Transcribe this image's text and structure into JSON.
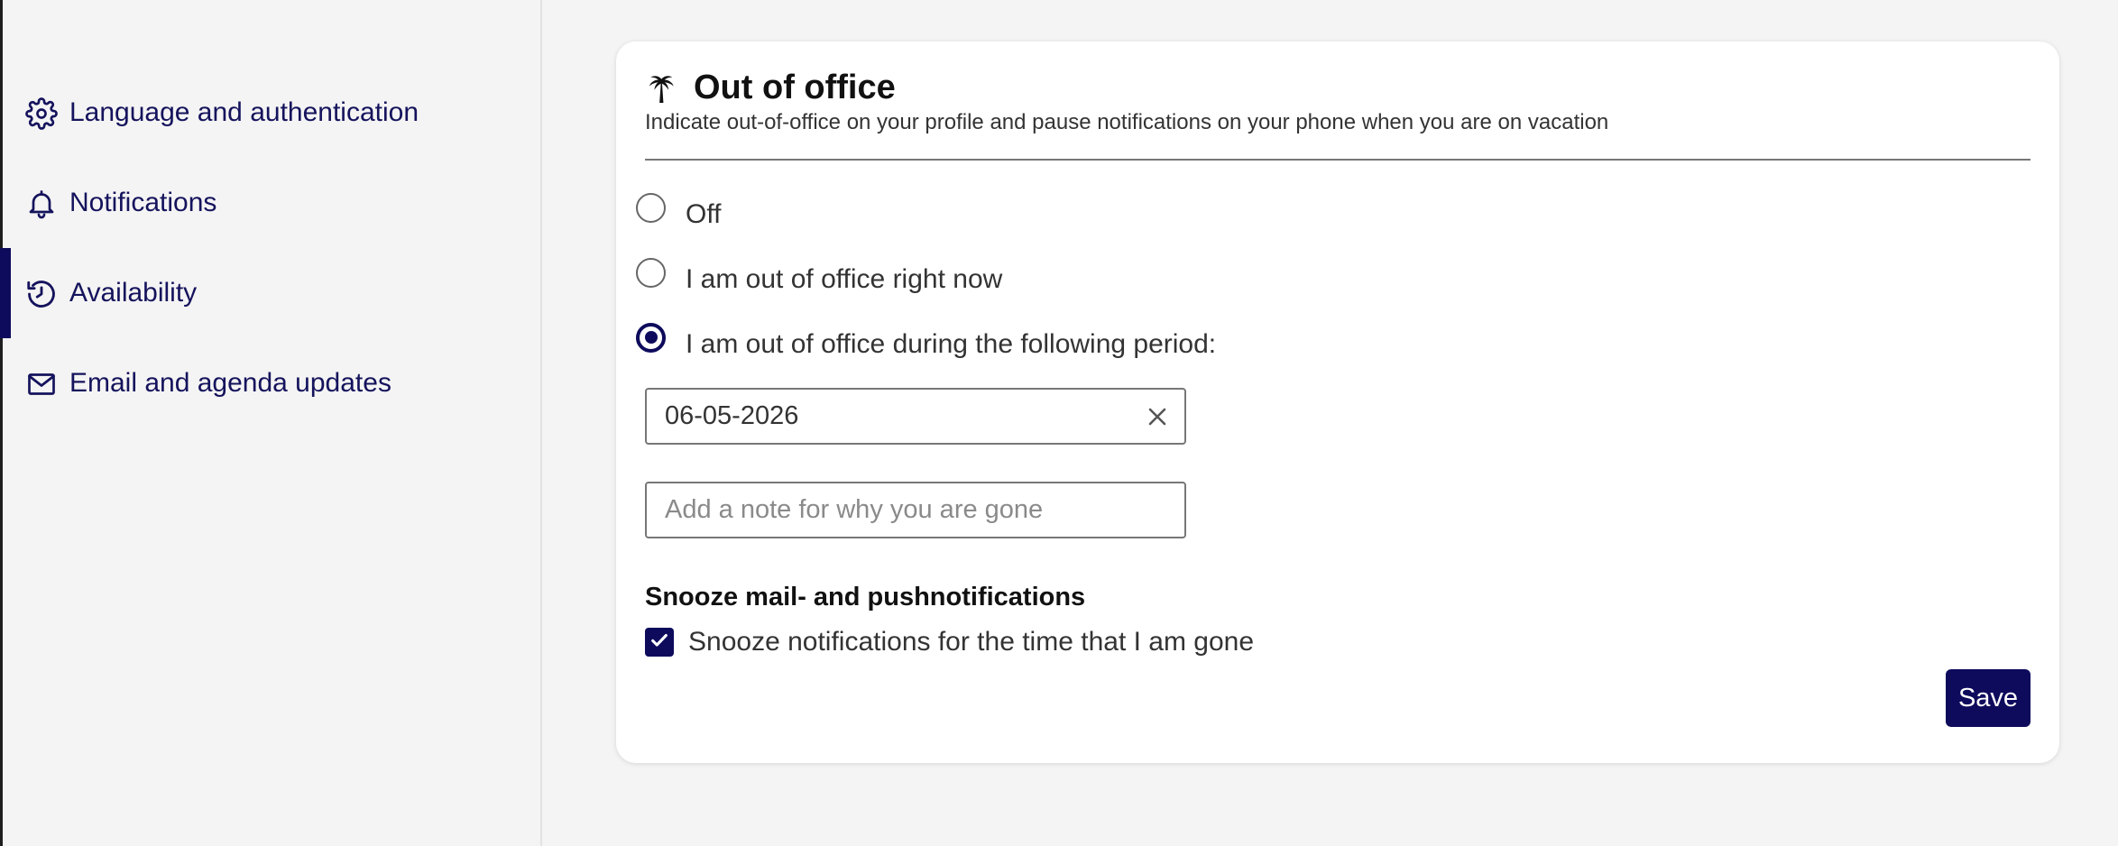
{
  "sidebar": {
    "items": [
      {
        "label": "Language and authentication",
        "icon": "gear-icon"
      },
      {
        "label": "Notifications",
        "icon": "bell-icon"
      },
      {
        "label": "Availability",
        "icon": "history-clock-icon",
        "active": true
      },
      {
        "label": "Email and agenda updates",
        "icon": "envelope-icon"
      }
    ]
  },
  "card": {
    "icon": "palm-tree-icon",
    "title": "Out of office",
    "subtitle": "Indicate out-of-office on your profile and pause notifications on your phone when you are on vacation",
    "options": [
      {
        "label": "Off",
        "checked": false
      },
      {
        "label": "I am out of office right now",
        "checked": false
      },
      {
        "label": "I am out of office during the following period:",
        "checked": true
      }
    ],
    "date_value": "06-05-2026",
    "note_placeholder": "Add a note for why you are gone",
    "snooze_heading": "Snooze mail- and pushnotifications",
    "snooze_label": "Snooze notifications for the time that I am gone",
    "snooze_checked": true,
    "save_label": "Save"
  },
  "colors": {
    "accent": "#0e0b5c",
    "nav_text": "#15135c",
    "background": "#f4f4f4",
    "card": "#ffffff"
  }
}
